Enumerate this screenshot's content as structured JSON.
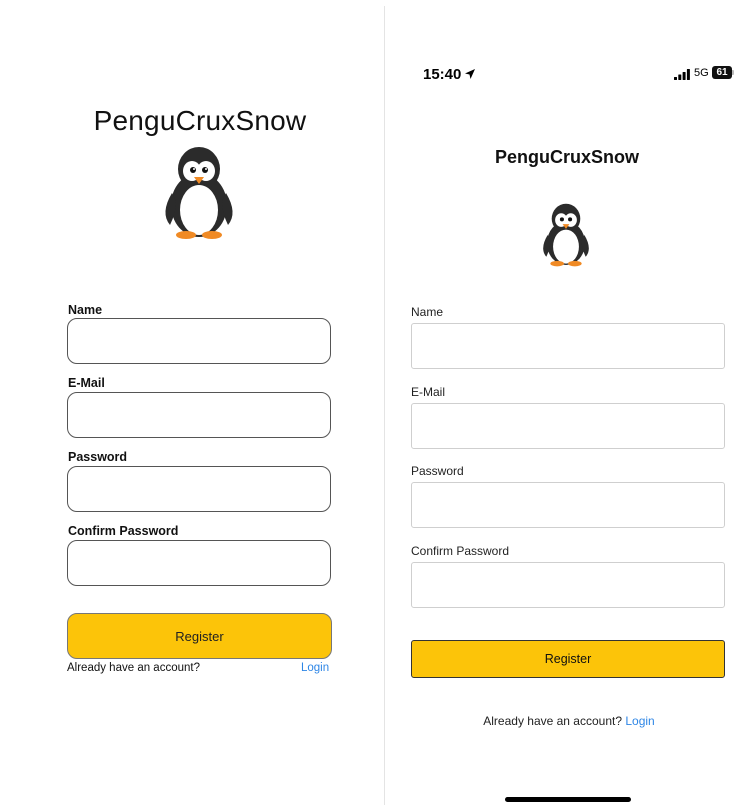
{
  "left_panel": {
    "app_title": "PenguCruxSnow",
    "logo_icon": "penguin-icon",
    "fields": [
      {
        "label": "Name",
        "value": "",
        "placeholder": ""
      },
      {
        "label": "E-Mail",
        "value": "",
        "placeholder": ""
      },
      {
        "label": "Password",
        "value": "",
        "placeholder": ""
      },
      {
        "label": "Confirm Password",
        "value": "",
        "placeholder": ""
      }
    ],
    "register_label": "Register",
    "already_text": "Already have an account?",
    "login_label": "Login"
  },
  "right_panel": {
    "status_bar": {
      "time": "15:40",
      "location_icon": "location-arrow-icon",
      "signal_icon": "cellular-signal-icon",
      "network": "5G",
      "battery": "61"
    },
    "app_title": "PenguCruxSnow",
    "logo_icon": "penguin-icon",
    "fields": [
      {
        "label": "Name",
        "value": "",
        "placeholder": ""
      },
      {
        "label": "E-Mail",
        "value": "",
        "placeholder": ""
      },
      {
        "label": "Password",
        "value": "",
        "placeholder": ""
      },
      {
        "label": "Confirm Password",
        "value": "",
        "placeholder": ""
      }
    ],
    "register_label": "Register",
    "already_text": "Already have an account?",
    "login_label": "Login"
  },
  "colors": {
    "accent_button": "#fcc409",
    "link": "#2e86e6",
    "penguin_body": "#2b2b2b",
    "penguin_beak_feet": "#f08a24"
  }
}
